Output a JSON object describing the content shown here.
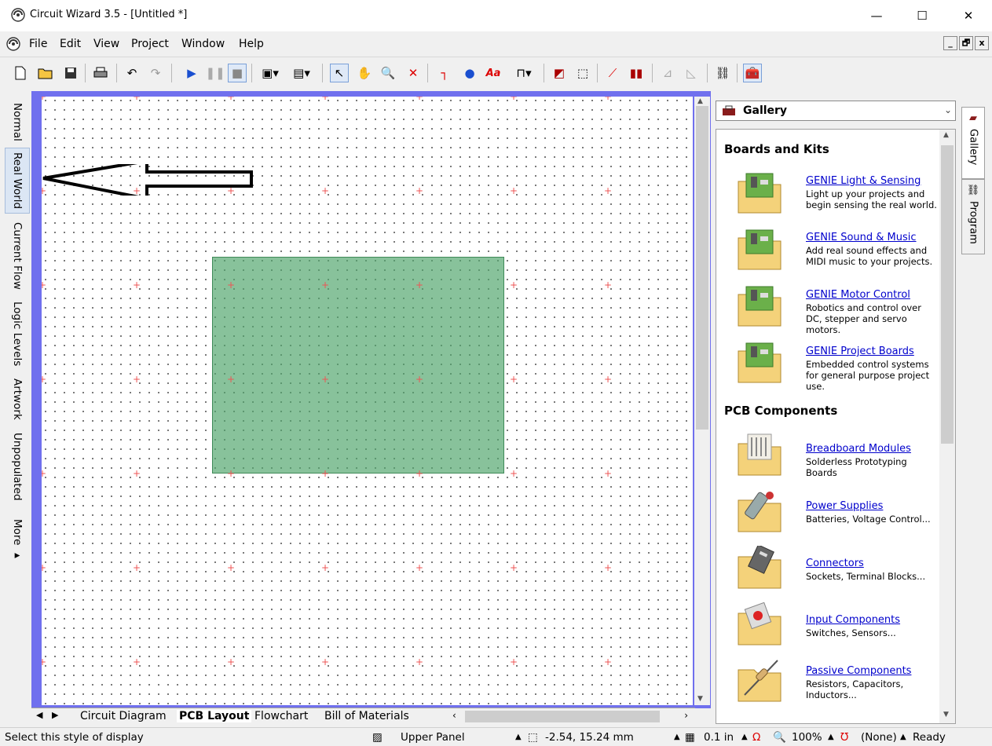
{
  "window": {
    "title": "Circuit Wizard 3.5 - [Untitled *]",
    "minimize": "—",
    "maximize": "☐",
    "close": "✕"
  },
  "menu": {
    "items": [
      "File",
      "Edit",
      "View",
      "Project",
      "Window",
      "Help"
    ]
  },
  "mdi": {
    "min": "_",
    "restore": "🗗",
    "close": "x"
  },
  "side_tabs": {
    "items": [
      "Normal",
      "Real World",
      "Current Flow",
      "Logic Levels",
      "Artwork",
      "Unpopulated",
      "More ▸"
    ],
    "active": "Real World"
  },
  "doc_tabs": {
    "items": [
      "Circuit Diagram",
      "PCB Layout",
      "Flowchart",
      "Bill of Materials"
    ],
    "active": "PCB Layout"
  },
  "status": {
    "hint": "Select this style of display",
    "panel": "Upper Panel",
    "coords": "-2.54, 15.24 mm",
    "grid": "0.1 in",
    "zoom": "100%",
    "probe": "(None)",
    "state": "Ready"
  },
  "gallery": {
    "dropdown_label": "Gallery",
    "sections": [
      {
        "title": "Boards and Kits",
        "items": [
          {
            "name": "GENIE Light & Sensing",
            "desc": "Light up your projects and begin sensing the real world."
          },
          {
            "name": "GENIE Sound & Music",
            "desc": "Add real sound effects and MIDI music to your projects."
          },
          {
            "name": "GENIE Motor Control",
            "desc": "Robotics and control over DC, stepper and servo motors."
          },
          {
            "name": "GENIE Project Boards",
            "desc": "Embedded control systems for general purpose project use."
          }
        ]
      },
      {
        "title": "PCB Components",
        "items": [
          {
            "name": "Breadboard Modules",
            "desc": "Solderless Prototyping Boards"
          },
          {
            "name": "Power Supplies",
            "desc": "Batteries, Voltage Control..."
          },
          {
            "name": "Connectors",
            "desc": "Sockets, Terminal Blocks..."
          },
          {
            "name": "Input Components",
            "desc": "Switches, Sensors..."
          },
          {
            "name": "Passive Components",
            "desc": "Resistors, Capacitors, Inductors..."
          }
        ]
      }
    ]
  },
  "right_tabs": {
    "gallery": "Gallery",
    "program": "Program"
  },
  "colors": {
    "canvas_frame": "#7070ee",
    "pcb_board": "#79bd8f",
    "link": "#0000cc"
  }
}
